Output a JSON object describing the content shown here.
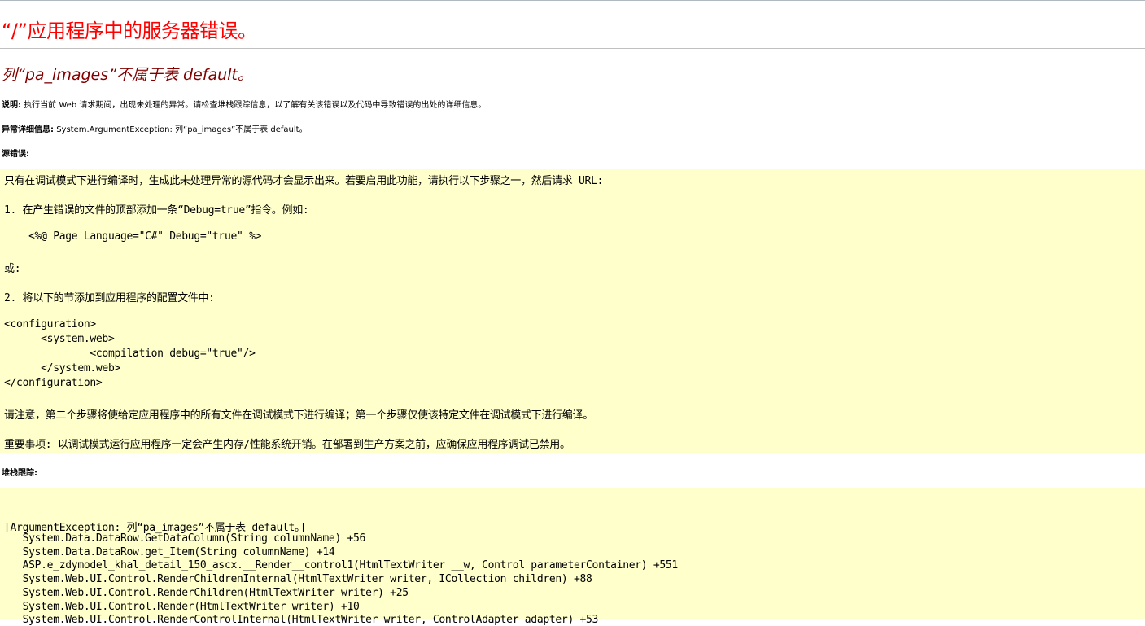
{
  "error_page": {
    "title": "“/”应用程序中的服务器错误。",
    "error_message": "列“pa_images”不属于表 default。",
    "description": {
      "label": "说明:",
      "text": "执行当前 Web 请求期间，出现未处理的异常。请检查堆栈跟踪信息，以了解有关该错误以及代码中导致错误的出处的详细信息。"
    },
    "exception_details": {
      "label": "异常详细信息:",
      "text": "System.ArgumentException: 列“pa_images”不属于表 default。"
    },
    "source_error": {
      "label": "源错误:",
      "lines": [
        "只有在调试模式下进行编译时，生成此未处理异常的源代码才会显示出来。若要启用此功能，请执行以下步骤之一，然后请求 URL:",
        "1. 在产生错误的文件的顶部添加一条“Debug=true”指令。例如:",
        "    <%@ Page Language=\"C#\" Debug=\"true\" %>",
        "或:",
        "2. 将以下的节添加到应用程序的配置文件中:",
        "<configuration>",
        "      <system.web>",
        "              <compilation debug=\"true\"/>",
        "      </system.web>",
        "</configuration>",
        "请注意，第二个步骤将使给定应用程序中的所有文件在调试模式下进行编译；第一个步骤仅使该特定文件在调试模式下进行编译。",
        "重要事项: 以调试模式运行应用程序一定会产生内存/性能系统开销。在部署到生产方案之前，应确保应用程序调试已禁用。"
      ]
    },
    "stack_trace": {
      "label": "堆栈跟踪:",
      "lines": [
        "[ArgumentException: 列“pa_images”不属于表 default。]",
        "   System.Data.DataRow.GetDataColumn(String columnName) +56",
        "   System.Data.DataRow.get_Item(String columnName) +14",
        "   ASP.e_zdymodel_khal_detail_150_ascx.__Render__control1(HtmlTextWriter __w, Control parameterContainer) +551",
        "   System.Web.UI.Control.RenderChildrenInternal(HtmlTextWriter writer, ICollection children) +88",
        "   System.Web.UI.Control.RenderChildren(HtmlTextWriter writer) +25",
        "   System.Web.UI.Control.Render(HtmlTextWriter writer) +10",
        "   System.Web.UI.Control.RenderControlInternal(HtmlTextWriter writer, ControlAdapter adapter) +53"
      ]
    },
    "colors": {
      "title": "#ff0000",
      "error_message": "#800000",
      "code_background": "#ffffcc"
    }
  }
}
